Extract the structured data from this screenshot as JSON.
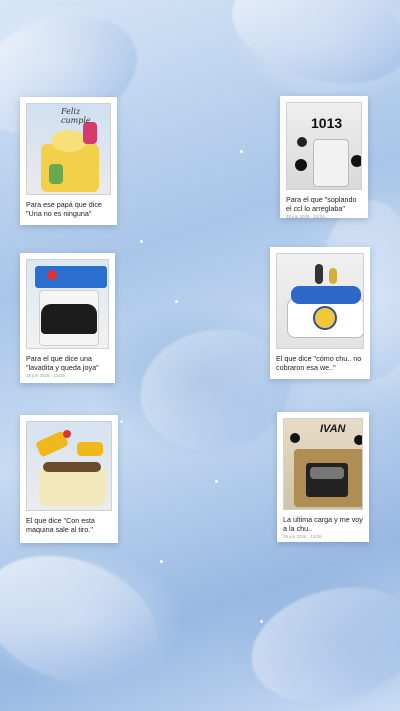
{
  "posts": [
    {
      "caption": "Para ese papá que dice \"Una no es ninguna\"",
      "date": ""
    },
    {
      "caption": "Para el que \"soplando el ccl lo arreglaba\"",
      "date": "19 jun 2026 · 12/26"
    },
    {
      "caption": "Para el que dice una \"lavadita y queda joya\"",
      "date": "19 jun 2026 · 12/26"
    },
    {
      "caption": "El que dice \"cómo chu.. no cobraron esa we..\"",
      "date": ""
    },
    {
      "caption": "El que dice \"Con esta maquina sale al tiro.\"",
      "date": ""
    },
    {
      "caption": "La ultima carga y me voy a la chu..",
      "date": "19 jun 2026 · 12/26"
    }
  ],
  "thumb_text": {
    "t1": "Feliz cumple",
    "t2": "1013",
    "t6": "IVAN"
  },
  "colors": {
    "background": "#bcd3ee",
    "card": "#ffffff"
  }
}
